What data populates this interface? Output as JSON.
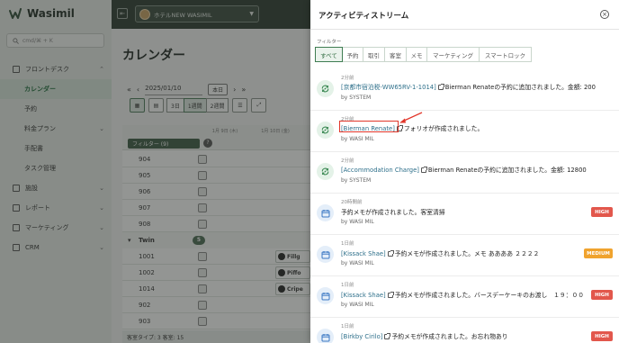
{
  "app": {
    "name": "Wasimil"
  },
  "sidebar": {
    "search_placeholder": "cmd/⌘ + K",
    "items": [
      {
        "label": "フロントデスク",
        "type": "section",
        "expanded": true
      },
      {
        "label": "カレンダー",
        "type": "sub",
        "active": true
      },
      {
        "label": "予約",
        "type": "sub"
      },
      {
        "label": "料金プラン",
        "type": "sub",
        "has_chevron": true
      },
      {
        "label": "手配書",
        "type": "sub"
      },
      {
        "label": "タスク管理",
        "type": "sub"
      },
      {
        "label": "施設",
        "type": "section",
        "has_chevron": true
      },
      {
        "label": "レポート",
        "type": "section",
        "has_chevron": true
      },
      {
        "label": "マーケティング",
        "type": "section",
        "has_chevron": true
      },
      {
        "label": "CRM",
        "type": "section",
        "has_chevron": true
      }
    ]
  },
  "topbar": {
    "hotel_name": "ホテルNEW WASIMIL"
  },
  "calendar": {
    "title": "カレンダー",
    "date": "2025/01/10",
    "today_label": "本日",
    "view_options": [
      "3日",
      "1週間",
      "2週間"
    ],
    "selected_view": "1週間",
    "filter_label": "フィルター (9)",
    "day_headers": [
      "1月 9日 (木)",
      "1月 10日 (金)"
    ],
    "rooms_top": [
      "904",
      "905",
      "906",
      "907",
      "908"
    ],
    "group": {
      "name": "Twin",
      "count": "5"
    },
    "rooms_twin": [
      "1001",
      "1002",
      "1014",
      "902",
      "903"
    ],
    "bookings": [
      "Fillg",
      "Piffo",
      "Cripe"
    ],
    "footer": "客室タイプ: 3  客室: 15"
  },
  "drawer": {
    "title": "アクティビティストリーム",
    "filter_label": "フィルター",
    "filters": [
      "すべて",
      "予約",
      "取引",
      "客室",
      "メモ",
      "マーケティング",
      "スマートロック"
    ],
    "selected_filter": "すべて",
    "entries": [
      {
        "icon": "sync",
        "time": "2分前",
        "link": "[京都市宿泊税-WW65RV-1-1014]",
        "text": "Bierman Renateの予約に追加されました。金額: 200",
        "by": "by SYSTEM",
        "badge": ""
      },
      {
        "icon": "sync",
        "time": "2分前",
        "link": "[Bierman Renate]",
        "text": "フォリオが作成されました。",
        "by": "by WASI MIL",
        "badge": "",
        "highlight": true
      },
      {
        "icon": "sync",
        "time": "2分前",
        "link": "[Accommodation Charge]",
        "text": "Bierman Renateの予約に追加されました。金額: 12800",
        "by": "by SYSTEM",
        "badge": ""
      },
      {
        "icon": "memo",
        "time": "20時間前",
        "link": "",
        "text": "予約メモが作成されました。客室清掃",
        "by": "by WASI MIL",
        "badge": "HIGH"
      },
      {
        "icon": "memo",
        "time": "1日前",
        "link": "[Kissack Shae]",
        "text": "予約メモが作成されました。メモ ああああ ２２２２",
        "by": "by WASI MIL",
        "badge": "MEDIUM"
      },
      {
        "icon": "memo",
        "time": "1日前",
        "link": "[Kissack Shae]",
        "text": "予約メモが作成されました。バースデーケーキのお渡し　１９：００",
        "by": "by WASI MIL",
        "badge": "HIGH"
      },
      {
        "icon": "memo",
        "time": "1日前",
        "link": "[Birkby Cirilo]",
        "text": "予約メモが作成されました。お忘れ物あり",
        "by": "",
        "badge": "HIGH"
      }
    ]
  },
  "colors": {
    "accent": "#3f7d52",
    "high": "#e2574c",
    "medium": "#f0a32e",
    "link": "#2d6f8a",
    "annotation": "#e2362a"
  }
}
